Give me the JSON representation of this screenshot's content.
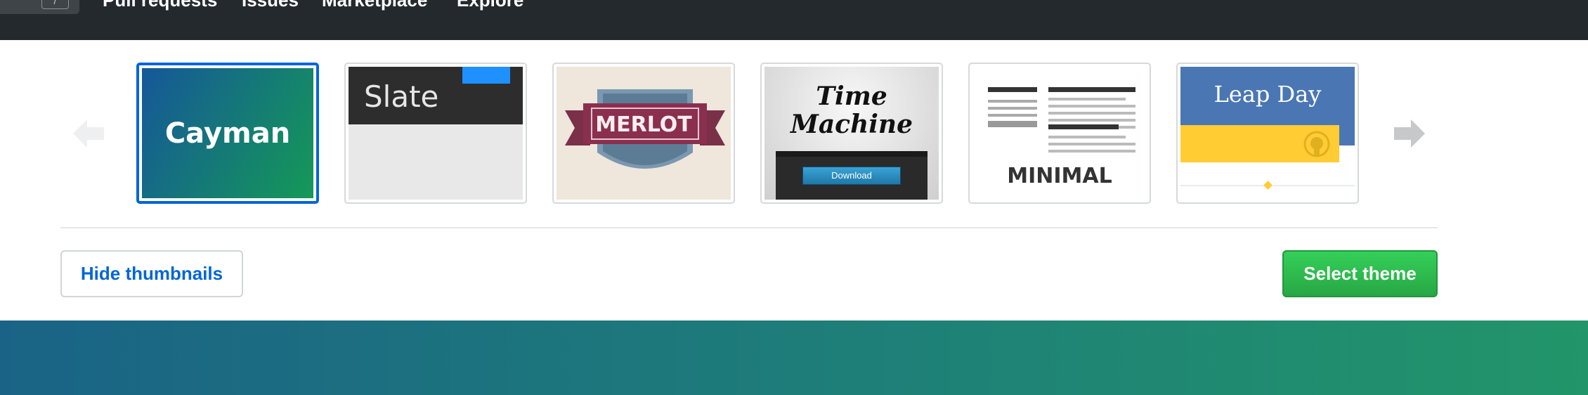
{
  "nav": {
    "slash_key": "/",
    "items": [
      "Pull requests",
      "Issues",
      "Marketplace",
      "Explore"
    ]
  },
  "themes": [
    {
      "name": "Cayman",
      "label": "Cayman",
      "selected": true
    },
    {
      "name": "Slate",
      "label": "Slate",
      "selected": false
    },
    {
      "name": "Merlot",
      "label": "MERLOT",
      "selected": false
    },
    {
      "name": "Time Machine",
      "label_line1": "Time",
      "label_line2": "Machine",
      "button": "Download",
      "selected": false
    },
    {
      "name": "Minimal",
      "label": "MINIMAL",
      "selected": false
    },
    {
      "name": "Leap Day",
      "label": "Leap Day",
      "selected": false
    }
  ],
  "buttons": {
    "hide_thumbnails": "Hide thumbnails",
    "select_theme": "Select theme"
  },
  "colors": {
    "topbar": "#24292e",
    "link_blue": "#0366d6",
    "select_green": "#28a745",
    "cayman_start": "#155799",
    "cayman_end": "#159957"
  },
  "icons": [
    "arrow-left-icon",
    "arrow-right-icon",
    "octocat-icon"
  ]
}
